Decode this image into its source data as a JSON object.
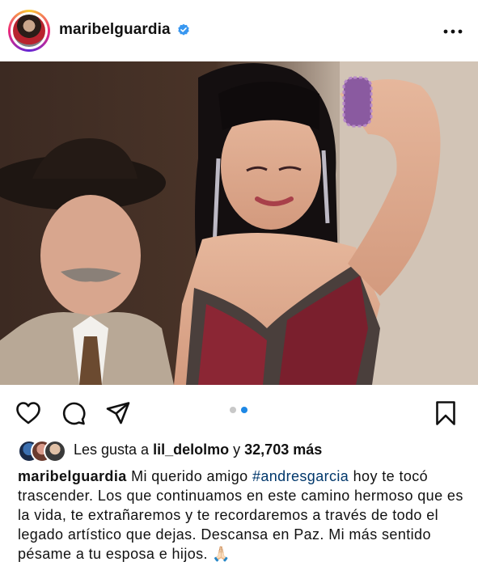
{
  "post": {
    "username": "maribelguardia",
    "verified": true
  },
  "carousel": {
    "count": 2,
    "active_index": 2
  },
  "likes": {
    "prefix": "Les gusta a",
    "user": "lil_delolmo",
    "conjunction": "y",
    "count": "32,703",
    "suffix": "más"
  },
  "caption": {
    "username": "maribelguardia",
    "lead": "Mi querido amigo",
    "hashtag": "#andresgarcia",
    "body": "hoy te tocó trascender. Los que continuamos en este camino hermoso que es la vida, te extrañaremos y te recordaremos a través de todo el legado artístico que dejas. Descansa en Paz. Mi más sentido pésame a tu esposa e hijos. 🙏🏻"
  },
  "icons": {
    "verified": "verified-badge-icon",
    "more": "more-options-icon",
    "like": "heart-icon",
    "comment": "comment-icon",
    "share": "share-icon",
    "save": "bookmark-icon"
  },
  "colors": {
    "verified": "#3897f0",
    "active_dot": "#1e88e5",
    "hashtag": "#00376b"
  }
}
